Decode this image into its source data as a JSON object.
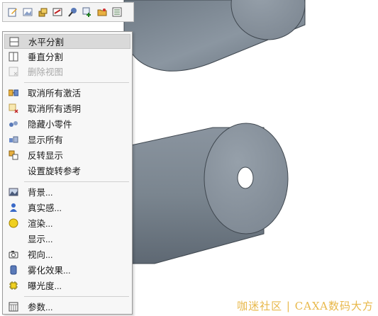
{
  "toolbar": {
    "icons": [
      "edit-icon",
      "image-icon",
      "cube-stack-icon",
      "sketch-icon",
      "probe-icon",
      "add-view-icon",
      "folder-icon",
      "list-icon"
    ]
  },
  "menu": {
    "items": [
      {
        "label": "水平分割",
        "icon": "split-horizontal-icon",
        "enabled": true,
        "highlighted": true
      },
      {
        "label": "垂直分割",
        "icon": "split-vertical-icon",
        "enabled": true
      },
      {
        "label": "删除视图",
        "icon": "delete-view-icon",
        "enabled": false
      },
      {
        "label": "取消所有激活",
        "icon": "deactivate-all-icon",
        "enabled": true
      },
      {
        "label": "取消所有透明",
        "icon": "cancel-transparency-icon",
        "enabled": true
      },
      {
        "label": "隐藏小零件",
        "icon": "hide-small-parts-icon",
        "enabled": true
      },
      {
        "label": "显示所有",
        "icon": "show-all-icon",
        "enabled": true
      },
      {
        "label": "反转显示",
        "icon": "invert-display-icon",
        "enabled": true
      },
      {
        "label": "设置旋转参考",
        "icon": "",
        "enabled": true
      },
      {
        "label": "背景...",
        "icon": "background-icon",
        "enabled": true
      },
      {
        "label": "真实感...",
        "icon": "realism-icon",
        "enabled": true
      },
      {
        "label": "渲染...",
        "icon": "render-icon",
        "enabled": true
      },
      {
        "label": "显示...",
        "icon": "",
        "enabled": true
      },
      {
        "label": "视向...",
        "icon": "camera-icon",
        "enabled": true
      },
      {
        "label": "雾化效果...",
        "icon": "fog-icon",
        "enabled": true
      },
      {
        "label": "曝光度...",
        "icon": "exposure-icon",
        "enabled": true
      },
      {
        "label": "参数...",
        "icon": "parameters-icon",
        "enabled": true
      }
    ]
  },
  "watermark": "咖迷社区 | CAXA数码大方",
  "colors": {
    "highlight": "#d9d9d9",
    "disabled_text": "#a8a8a8",
    "model_face": "#7d8894",
    "watermark": "#e8b84a"
  }
}
